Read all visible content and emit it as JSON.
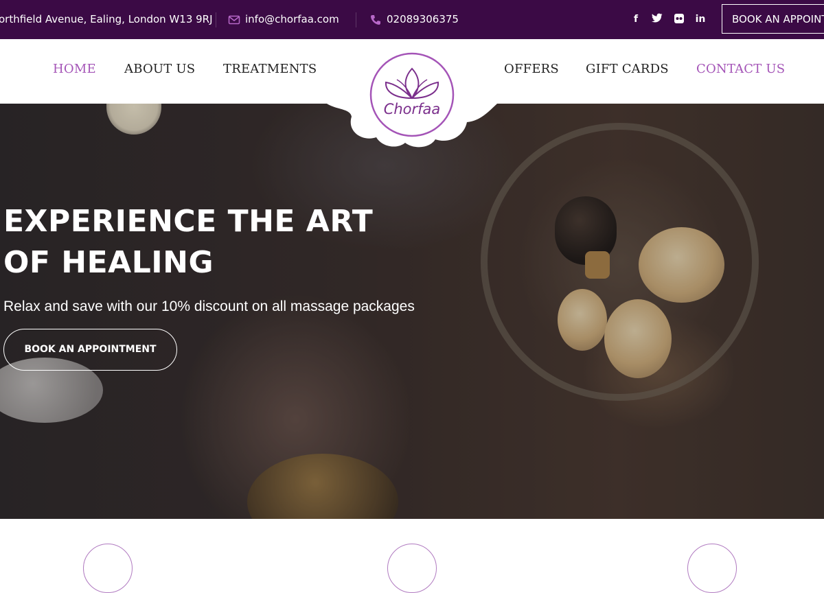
{
  "topbar": {
    "address": "orthfield Avenue, Ealing, London W13 9RJ",
    "email": "info@chorfaa.com",
    "phone": "02089306375",
    "social": [
      "facebook-icon",
      "twitter-icon",
      "flickr-icon",
      "linkedin-icon"
    ],
    "book_label": "BOOK AN APPOINT"
  },
  "nav": {
    "items": [
      {
        "label": "HOME",
        "active": true
      },
      {
        "label": "ABOUT US",
        "active": false
      },
      {
        "label": "TREATMENTS",
        "active": false
      },
      {
        "label": "OFFERS",
        "active": false
      },
      {
        "label": "GIFT CARDS",
        "active": false
      },
      {
        "label": "CONTACT US",
        "active": true
      }
    ]
  },
  "logo": {
    "text": "Chorfaa"
  },
  "hero": {
    "title": "EXPERIENCE THE ART OF HEALING",
    "subtitle": "Relax and save with our 10% discount on all massage packages",
    "button_label": "BOOK AN APPOINTMENT"
  },
  "colors": {
    "topbar_bg": "#3b0a45",
    "accent": "#a454b7",
    "nav_text": "#222222",
    "logo": "#7b2f8c"
  }
}
